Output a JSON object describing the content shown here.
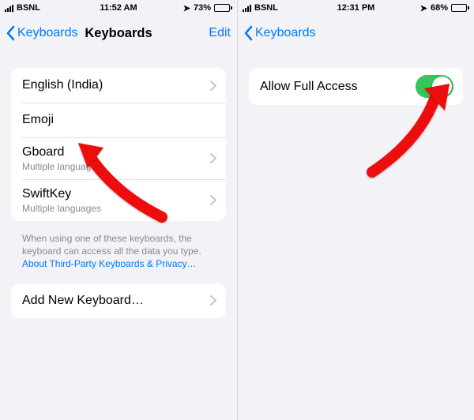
{
  "left": {
    "status": {
      "carrier": "BSNL",
      "time": "11:52 AM",
      "battery_pct": "73%",
      "battery_fill": "73%"
    },
    "nav": {
      "back": "Keyboards",
      "title": "Keyboards",
      "edit": "Edit"
    },
    "keyboards": [
      {
        "label": "English (India)",
        "sub": "",
        "chevron": true
      },
      {
        "label": "Emoji",
        "sub": "",
        "chevron": false
      },
      {
        "label": "Gboard",
        "sub": "Multiple languages",
        "chevron": true
      },
      {
        "label": "SwiftKey",
        "sub": "Multiple languages",
        "chevron": true
      }
    ],
    "footer": {
      "text": "When using one of these keyboards, the keyboard can access all the data you type. ",
      "link": "About Third-Party Keyboards & Privacy…"
    },
    "add_row": {
      "label": "Add New Keyboard…"
    }
  },
  "right": {
    "status": {
      "carrier": "BSNL",
      "time": "12:31 PM",
      "battery_pct": "68%",
      "battery_fill": "68%"
    },
    "nav": {
      "back": "Keyboards"
    },
    "row": {
      "label": "Allow Full Access",
      "toggle_on": true
    }
  },
  "colors": {
    "accent": "#007aff",
    "toggle_on": "#34c759"
  }
}
